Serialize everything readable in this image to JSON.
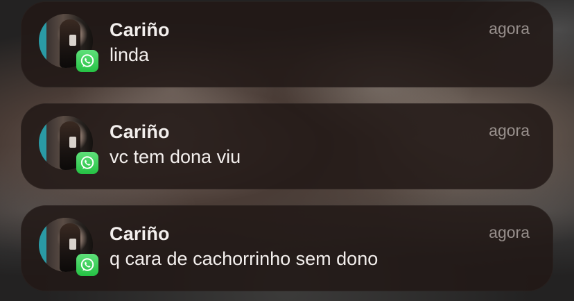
{
  "notifications": [
    {
      "app_icon": "whatsapp-icon",
      "title": "Cariño",
      "time": "agora",
      "message": "linda"
    },
    {
      "app_icon": "whatsapp-icon",
      "title": "Cariño",
      "time": "agora",
      "message": "vc tem dona viu"
    },
    {
      "app_icon": "whatsapp-icon",
      "title": "Cariño",
      "time": "agora",
      "message": "q cara de cachorrinho sem dono"
    }
  ],
  "colors": {
    "whatsapp_green": "#25c244",
    "card_background": "#221816",
    "text_primary": "#f3efed",
    "text_secondary": "#b8aeaa"
  }
}
